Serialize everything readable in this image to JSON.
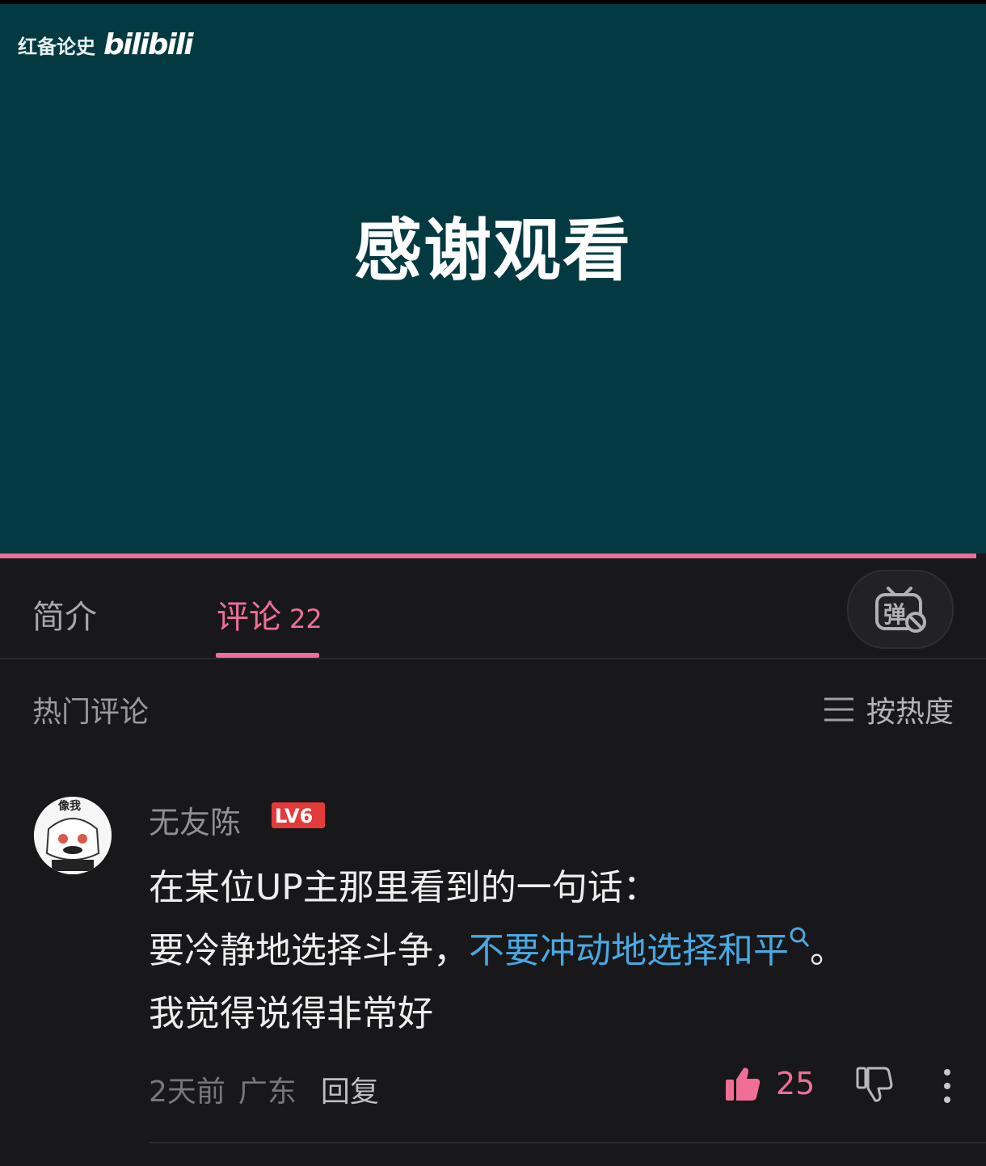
{
  "video": {
    "channel_name": "红备论史",
    "platform_logo": "bilibili",
    "end_title": "感谢观看",
    "progress_percent": 99
  },
  "tabs": {
    "intro_label": "简介",
    "comments_label": "评论",
    "comments_count": "22",
    "danmaku_icon_glyph": "弹"
  },
  "comments_section": {
    "heading": "热门评论",
    "sort_label": "按热度"
  },
  "comment": {
    "username": "无友陈",
    "level": "LV6",
    "avatar_text_top": "像我",
    "line1": "在某位UP主那里看到的一句话：",
    "line2_plain": "要冷静地选择斗争，",
    "line2_link": "不要冲动地选择和平",
    "line2_end": "。",
    "line3": "我觉得说得非常好",
    "time": "2天前",
    "location": "广东",
    "reply_label": "回复",
    "like_count": "25"
  },
  "colors": {
    "video_bg": "#033a41",
    "accent_pink": "#ef6f97",
    "link_blue": "#4aa8e0",
    "page_bg": "#18181a"
  }
}
